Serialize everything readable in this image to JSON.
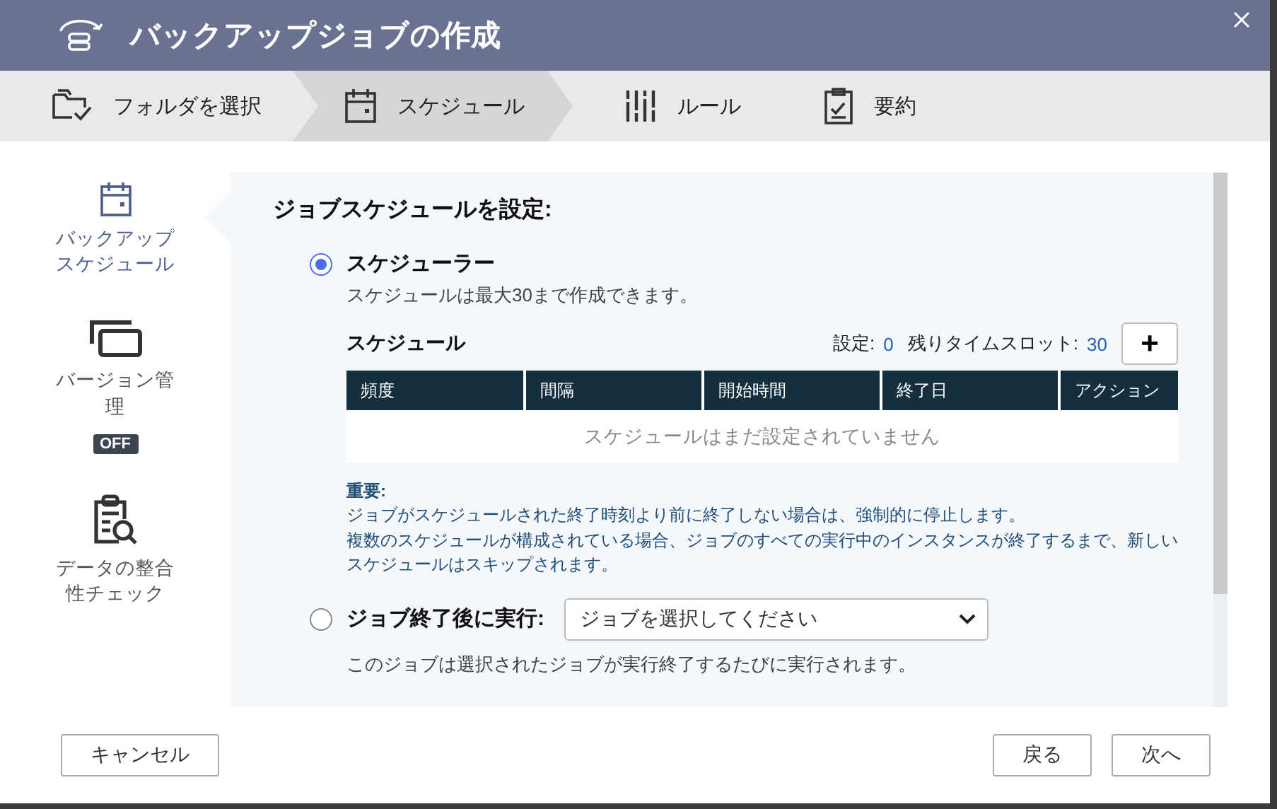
{
  "window": {
    "title": "バックアップジョブの作成"
  },
  "steps": [
    {
      "label": "フォルダを選択",
      "selected": false
    },
    {
      "label": "スケジュール",
      "selected": true
    },
    {
      "label": "ルール",
      "selected": false
    },
    {
      "label": "要約",
      "selected": false
    }
  ],
  "sidebar": {
    "items": [
      {
        "label": "バックアップスケジュール",
        "selected": true
      },
      {
        "label": "バージョン管理",
        "selected": false,
        "badge": "OFF"
      },
      {
        "label": "データの整合性チェック",
        "selected": false
      }
    ]
  },
  "content": {
    "heading": "ジョブスケジュールを設定:",
    "options": [
      {
        "kind": "scheduler",
        "label": "スケジューラー",
        "selected": true,
        "note": "スケジュールは最大30まで作成できます。",
        "schedule": {
          "title": "スケジュール",
          "set_label": "設定:",
          "set_value": "0",
          "remaining_label": "残りタイムスロット:",
          "remaining_value": "30",
          "add": "+",
          "columns": [
            "頻度",
            "間隔",
            "開始時間",
            "終了日",
            "アクション"
          ],
          "empty": "スケジュールはまだ設定されていません"
        },
        "important": {
          "label": "重要:",
          "lines": [
            "ジョブがスケジュールされた終了時刻より前に終了しない場合は、強制的に停止します。",
            "複数のスケジュールが構成されている場合、ジョブのすべての実行中のインスタンスが終了するまで、新しいスケジュールはスキップされます。"
          ]
        }
      },
      {
        "kind": "after_job",
        "label": "ジョブ終了後に実行:",
        "selected": false,
        "placeholder": "ジョブを選択してください",
        "note": "このジョブは選択されたジョブが実行終了するたびに実行されます。"
      }
    ]
  },
  "buttons": {
    "cancel": "キャンセル",
    "back": "戻る",
    "next": "次へ"
  }
}
